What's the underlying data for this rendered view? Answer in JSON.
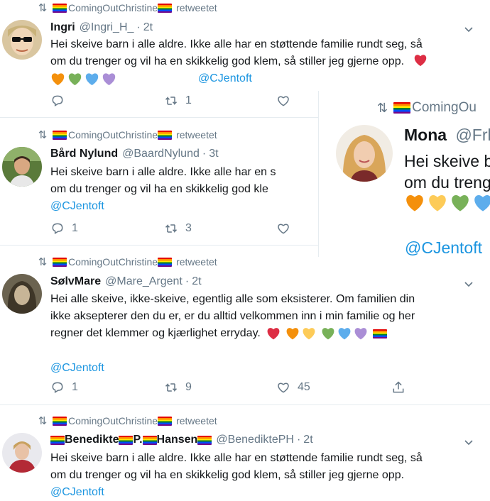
{
  "retweet_label": "retweetet",
  "retweeter": "ComingOutChristine",
  "tweets": [
    {
      "name": "Ingri",
      "handle": "@Ingri_H_",
      "time": "2t",
      "lines": [
        "Hei skeive barn i alle aldre. Ikke alle har en støttende familie rundt seg, så",
        "om du trenger og vil ha en skikkelig god klem, så stiller jeg gjerne opp."
      ],
      "mention": "@CJentoft",
      "reply_count": "",
      "retweet_count": "1",
      "like_count": ""
    },
    {
      "name": "Bård Nylund",
      "handle": "@BaardNylund",
      "time": "3t",
      "lines": [
        "Hei skeive barn i alle aldre. Ikke alle har en s",
        "om du trenger og vil ha en skikkelig god kle"
      ],
      "mention": "@CJentoft",
      "reply_count": "1",
      "retweet_count": "3",
      "like_count": ""
    },
    {
      "name": "SølvMare",
      "handle": "@Mare_Argent",
      "time": "2t",
      "lines": [
        "Hei alle skeive, ikke-skeive, egentlig alle som eksisterer. Om familien din",
        "ikke aksepterer den du er, er du alltid velkommen inn i min familie og her",
        "regner det klemmer og kjærlighet erryday."
      ],
      "mention": "@CJentoft",
      "reply_count": "1",
      "retweet_count": "9",
      "like_count": "45"
    },
    {
      "name_parts": [
        "Benedikte",
        "P.",
        "Hansen"
      ],
      "handle": "@BenediktePH",
      "time": "2t",
      "lines": [
        "Hei skeive barn i alle aldre. Ikke alle har en støttende familie rundt seg, så",
        "om du trenger og vil ha en skikkelig god klem, så stiller jeg gjerne opp."
      ],
      "mention": "@CJentoft"
    }
  ],
  "overlay": {
    "retweeter": "ComingOu",
    "name": "Mona",
    "handle": "@Frl",
    "line1": "Hei skeive b",
    "line2": "om du treng",
    "mention": "@CJentoft"
  },
  "colors": {
    "link": "#1b95e0",
    "muted": "#657786",
    "divider": "#e6ecf0"
  }
}
